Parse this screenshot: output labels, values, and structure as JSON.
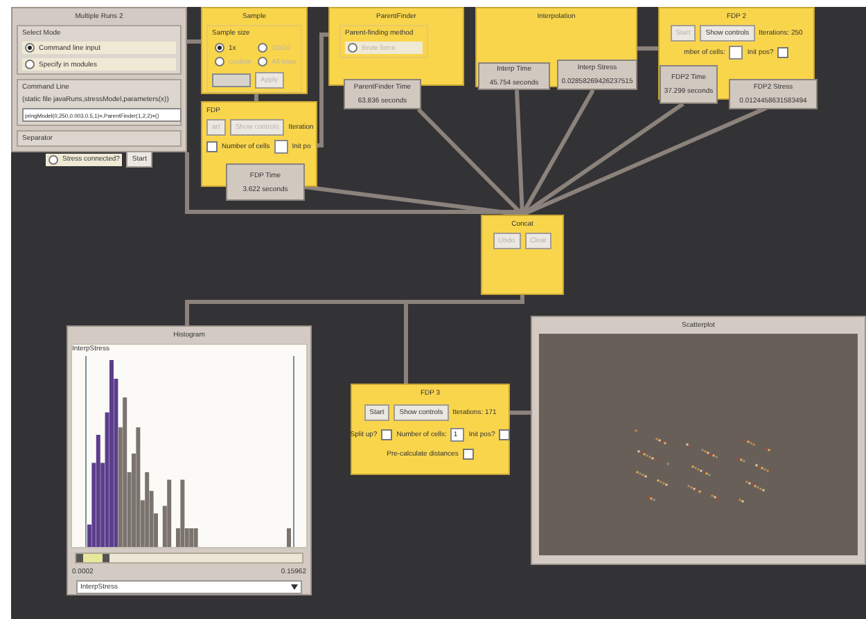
{
  "multiple_runs": {
    "title": "Multiple Runs 2",
    "mode_group": "Select Mode",
    "modes": [
      {
        "label": "Command line input",
        "selected": true
      },
      {
        "label": "Specify in modules",
        "selected": false
      }
    ],
    "command_group": "Command Line",
    "command_hint": "(static file javaRuns,stressModel,parameters(x))",
    "command_value": "pringModel(0,250,0.003,0.5,1)=,ParentFinder(1,2,2)=()",
    "separator_group": "Separator",
    "stress_connected": {
      "label": "Stress connected?",
      "selected": false
    },
    "start_button": "Start"
  },
  "sample": {
    "title": "Sample",
    "group": "Sample size",
    "options": [
      {
        "label": "1x",
        "selected": true
      },
      {
        "label": "10x10",
        "selected": false
      },
      {
        "label": "custom",
        "selected": false
      },
      {
        "label": "All rows",
        "selected": false
      }
    ],
    "size_field_disabled": true,
    "apply_button": {
      "label": "Apply",
      "disabled": true
    }
  },
  "fdp": {
    "title": "FDP",
    "start_button": {
      "label": "art",
      "disabled": true
    },
    "controls_button": {
      "label": "Show controls",
      "disabled": true
    },
    "iterations": "Iteration",
    "cells_checkbox": {
      "checked": false
    },
    "cells_label": "Number of cells",
    "init_pos_label": "Init po",
    "results": [
      {
        "label": "FDP Time",
        "value": "3.622 seconds"
      }
    ]
  },
  "parent_finder": {
    "title": "ParentFinder",
    "group": "Parent-finding method",
    "method": {
      "label": "Brute force",
      "selected": false,
      "disabled": true
    },
    "results": [
      {
        "label": "ParentFinder Time",
        "value": "63.836 seconds"
      }
    ]
  },
  "interpolation": {
    "title": "Interpolation",
    "results": [
      {
        "label": "Interp Time",
        "value": "45.754 seconds"
      },
      {
        "label": "Interp Stress",
        "value": "0.02858269426237515"
      }
    ]
  },
  "fdp_2": {
    "title": "FDP 2",
    "start_button": {
      "label": "Start",
      "disabled": true
    },
    "controls_button": {
      "label": "Show controls",
      "disabled": false
    },
    "iterations": "Iterations: 250",
    "cells_label": "mber of cells:",
    "init_pos_label": "Init pos?",
    "init_pos_checkbox": {
      "checked": false
    },
    "results": [
      {
        "label": "FDP2 Time",
        "value": "37.299 seconds"
      },
      {
        "label": "FDP2 Stress",
        "value": "0.0124458631583494"
      }
    ]
  },
  "concat": {
    "title": "Concat",
    "buttons": [
      {
        "label": "Undo",
        "disabled": true
      },
      {
        "label": "Clear",
        "disabled": true
      }
    ]
  },
  "histogram": {
    "title": "Histogram",
    "group": "InterpStress",
    "range_slider": {
      "level": 0.15
    },
    "min_label": "0.0002",
    "max_label": "0.15962",
    "attribute_select": "InterpStress"
  },
  "fdp_3": {
    "title": "FDP 3",
    "start_button": {
      "label": "Start",
      "disabled": false
    },
    "controls_button": {
      "label": "Show controls",
      "disabled": false
    },
    "iterations": "Iterations: 171",
    "split_label": "Split up?",
    "split_checkbox": {
      "checked": false
    },
    "cells_label": "Number of cells:",
    "cells_value": "1",
    "init_pos_label": "Init pos?",
    "init_pos_checkbox": {
      "checked": false
    },
    "precalc_label": "Pre-calculate distances",
    "precalc_checkbox": {
      "checked": false
    }
  },
  "scatterplot": {
    "title": "Scatterplot"
  }
}
